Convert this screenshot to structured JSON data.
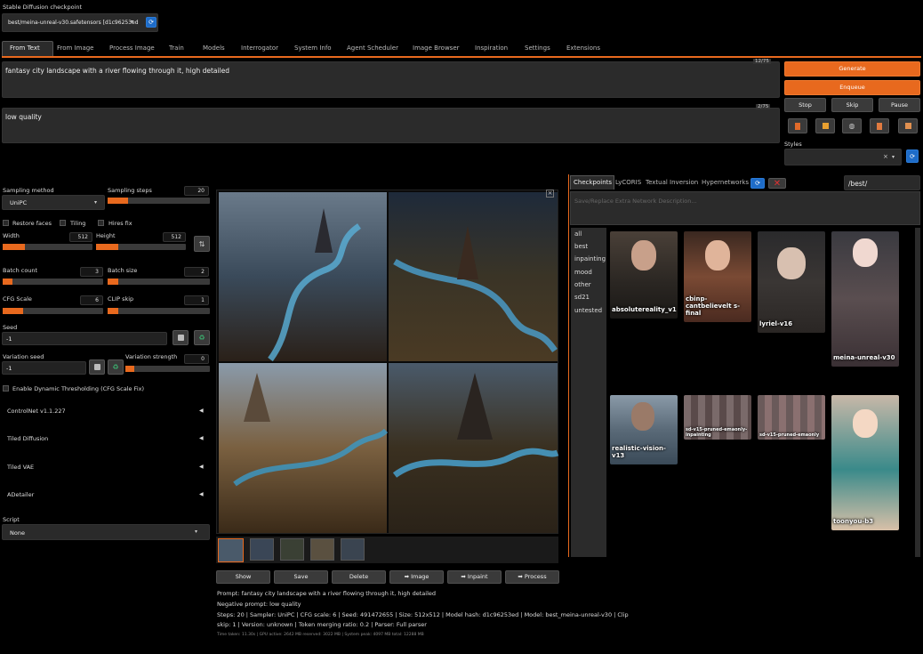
{
  "checkpoint": {
    "label": "Stable Diffusion checkpoint",
    "value": "best/meina-unreal-v30.safetensors [d1c96253ed"
  },
  "tabs": [
    "From Text",
    "From Image",
    "Process Image",
    "Train",
    "Models",
    "Interrogator",
    "System Info",
    "Agent Scheduler",
    "Image Browser",
    "Inspiration",
    "Settings",
    "Extensions"
  ],
  "prompt": {
    "text": "fantasy city landscape with a river flowing through it, high detailed",
    "count": "12/75"
  },
  "negative": {
    "text": "low quality",
    "count": "2/75"
  },
  "actions": {
    "generate": "Generate",
    "enqueue": "Enqueue",
    "stop": "Stop",
    "skip": "Skip",
    "pause": "Pause",
    "styles_label": "Styles"
  },
  "params": {
    "sampling_method": {
      "label": "Sampling method",
      "value": "UniPC"
    },
    "sampling_steps": {
      "label": "Sampling steps",
      "value": "20",
      "fraction": 0.2
    },
    "restore_faces": "Restore faces",
    "tiling": "Tiling",
    "hires_fix": "Hires fix",
    "width": {
      "label": "Width",
      "value": "512",
      "fraction": 0.25
    },
    "height": {
      "label": "Height",
      "value": "512",
      "fraction": 0.25
    },
    "batch_count": {
      "label": "Batch count",
      "value": "3",
      "fraction": 0.1
    },
    "batch_size": {
      "label": "Batch size",
      "value": "2",
      "fraction": 0.1
    },
    "cfg_scale": {
      "label": "CFG Scale",
      "value": "6",
      "fraction": 0.2
    },
    "clip_skip": {
      "label": "CLIP skip",
      "value": "1",
      "fraction": 0.1
    },
    "seed": {
      "label": "Seed",
      "value": "-1"
    },
    "variation_seed": {
      "label": "Variation seed",
      "value": "-1"
    },
    "variation_strength": {
      "label": "Variation strength",
      "value": "0",
      "fraction": 0.1
    },
    "dynamic_thresholding": "Enable Dynamic Thresholding (CFG Scale Fix)"
  },
  "accordions": [
    "ControlNet v1.1.227",
    "Tiled Diffusion",
    "Tiled VAE",
    "ADetailer"
  ],
  "script": {
    "label": "Script",
    "value": "None"
  },
  "gallery_buttons": [
    "Show",
    "Save",
    "Delete",
    "➡ Image",
    "➡ Inpaint",
    "➡ Process"
  ],
  "info": {
    "prompt_line": "Prompt: fantasy city landscape with a river flowing through it, high detailed",
    "negative_line": "Negative prompt: low quality",
    "params_line1": "Steps: 20 | Sampler: UniPC | CFG scale: 6 | Seed: 491472655 | Size: 512x512 | Model hash: d1c96253ed | Model: best_meina-unreal-v30 | Clip",
    "params_line2": "skip: 1 | Version: unknown | Token merging ratio: 0.2 | Parser: Full parser",
    "timing": "Time taken: 11.30s | GPU active: 2642 MB reserved: 3022 MB | System peak: 4097 MB total: 12288 MB"
  },
  "network": {
    "tabs": [
      "Checkpoints",
      "LyCORIS",
      "Textual Inversion",
      "Hypernetworks"
    ],
    "path": "/best/",
    "description_placeholder": "Save/Replace Extra Network Description...",
    "categories": [
      "all",
      "best",
      "inpainting",
      "mood",
      "other",
      "sd21",
      "untested"
    ],
    "cards": [
      "absolutereality_v1",
      "cbinp-cantbelievelt s-final",
      "lyriel-v16",
      "meina-unreal-v30",
      "realistic-vision-v13",
      "sd-v15-pruned-emaonly-inpainting",
      "sd-v15-pruned-emaonly",
      "toonyou-b3"
    ]
  },
  "colors": {
    "accent": "#e8691e",
    "background": "#000000",
    "panel": "#1c1c1c"
  }
}
